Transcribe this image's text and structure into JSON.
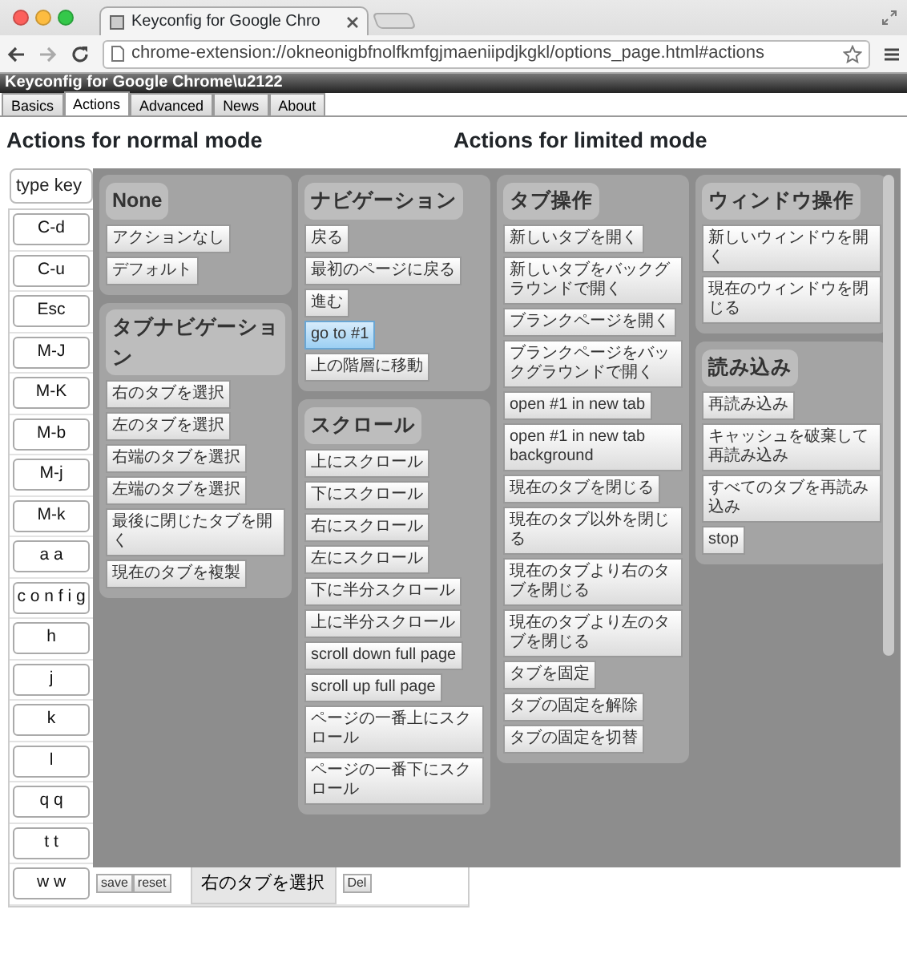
{
  "window": {
    "tab_title": "Keyconfig for Google Chro",
    "url": "chrome-extension://okneonigbfnolfkmfgjmaeniipdjkgkl/options_page.html#actions"
  },
  "app_title": "Keyconfig for Google Chrome\\u2122",
  "tabs": [
    {
      "label": "Basics",
      "selected": false
    },
    {
      "label": "Actions",
      "selected": true
    },
    {
      "label": "Advanced",
      "selected": false
    },
    {
      "label": "News",
      "selected": false
    },
    {
      "label": "About",
      "selected": false
    }
  ],
  "normal_heading": "Actions for normal mode",
  "limited_heading": "Actions for limited mode",
  "key_input": {
    "placeholder": "type key"
  },
  "keys": [
    "C-d",
    "C-u",
    "Esc",
    "M-J",
    "M-K",
    "M-b",
    "M-j",
    "M-k",
    "a a",
    "c o n f i g",
    "h",
    "j",
    "k",
    "l",
    "q q",
    "t t",
    "w w"
  ],
  "last_row": {
    "save": "save",
    "reset": "reset",
    "action": "右のタブを選択",
    "delete": "Del"
  },
  "action_menu": {
    "groups": [
      {
        "title": "None",
        "actions": [
          {
            "label": "アクションなし",
            "selected": false
          },
          {
            "label": "デフォルト",
            "selected": false
          }
        ]
      },
      {
        "title": "ナビゲーション",
        "actions": [
          {
            "label": "戻る",
            "selected": false
          },
          {
            "label": "最初のページに戻る",
            "selected": false
          },
          {
            "label": "進む",
            "selected": false
          },
          {
            "label": "go to #1",
            "selected": true
          },
          {
            "label": "上の階層に移動",
            "selected": false
          }
        ]
      },
      {
        "title": "タブ操作",
        "actions": [
          {
            "label": "新しいタブを開く",
            "selected": false
          },
          {
            "label": "新しいタブをバックグラウンドで開く",
            "selected": false
          },
          {
            "label": "ブランクページを開く",
            "selected": false
          },
          {
            "label": "ブランクページをバックグラウンドで開く",
            "selected": false
          },
          {
            "label": "open #1 in new tab",
            "selected": false
          },
          {
            "label": "open #1 in new tab background",
            "selected": false
          },
          {
            "label": "現在のタブを閉じる",
            "selected": false
          },
          {
            "label": "現在のタブ以外を閉じる",
            "selected": false
          },
          {
            "label": "現在のタブより右のタブを閉じる",
            "selected": false
          },
          {
            "label": "現在のタブより左のタブを閉じる",
            "selected": false
          },
          {
            "label": "タブを固定",
            "selected": false
          },
          {
            "label": "タブの固定を解除",
            "selected": false
          },
          {
            "label": "タブの固定を切替",
            "selected": false
          }
        ]
      },
      {
        "title": "ウィンドウ操作",
        "actions": [
          {
            "label": "新しいウィンドウを開く",
            "selected": false
          },
          {
            "label": "現在のウィンドウを閉じる",
            "selected": false
          }
        ]
      },
      {
        "title": "タブナビゲーション",
        "actions": [
          {
            "label": "右のタブを選択",
            "selected": false
          },
          {
            "label": "左のタブを選択",
            "selected": false
          },
          {
            "label": "右端のタブを選択",
            "selected": false
          },
          {
            "label": "左端のタブを選択",
            "selected": false
          },
          {
            "label": "最後に閉じたタブを開く",
            "selected": false
          },
          {
            "label": "現在のタブを複製",
            "selected": false
          }
        ]
      },
      {
        "title": "スクロール",
        "actions": [
          {
            "label": "上にスクロール",
            "selected": false
          },
          {
            "label": "下にスクロール",
            "selected": false
          },
          {
            "label": "右にスクロール",
            "selected": false
          },
          {
            "label": "左にスクロール",
            "selected": false
          },
          {
            "label": "下に半分スクロール",
            "selected": false
          },
          {
            "label": "上に半分スクロール",
            "selected": false
          },
          {
            "label": "scroll down full page",
            "selected": false
          },
          {
            "label": "scroll up full page",
            "selected": false
          },
          {
            "label": "ページの一番上にスクロール",
            "selected": false
          },
          {
            "label": "ページの一番下にスクロール",
            "selected": false
          }
        ]
      },
      {
        "title": "読み込み",
        "actions": [
          {
            "label": "再読み込み",
            "selected": false
          },
          {
            "label": "キャッシュを破棄して再読み込み",
            "selected": false
          },
          {
            "label": "すべてのタブを再読み込み",
            "selected": false
          },
          {
            "label": "stop",
            "selected": false
          }
        ]
      }
    ]
  }
}
